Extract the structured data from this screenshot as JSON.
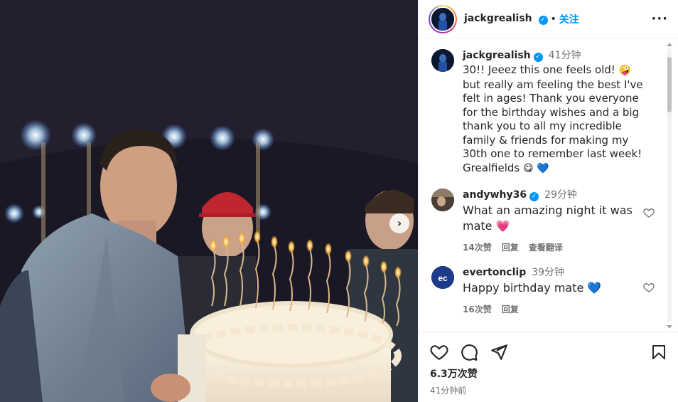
{
  "photo": {
    "next_glyph": "›",
    "icon": "chevron-right-icon"
  },
  "header": {
    "username": "jackgrealish",
    "verified_glyph": "✓",
    "separator": "•",
    "follow_label": "关注",
    "more_glyph": "···"
  },
  "caption": {
    "username": "jackgrealish",
    "time": "41分钟",
    "text_before_emoji": "30!! Jeeez this one feels old! ",
    "emoji1": "🤪",
    "text_middle": " but really am feeling the best I've felt in ages! Thank you everyone for the birthday wishes and a big thank you to all my incredible family & friends for making my 30th one to remember last week! Grealfields ",
    "emoji2": "😋",
    "emoji3": "💙"
  },
  "comments": [
    {
      "username": "andywhy36",
      "time": "29分钟",
      "text": "What an amazing night it was mate ",
      "emoji": "💗",
      "likes": "14次赞",
      "reply_label": "回复",
      "translate_label": "查看翻译"
    },
    {
      "username": "evertonclip",
      "time": "39分钟",
      "text": "Happy birthday mate ",
      "emoji": "💙",
      "likes": "16次赞",
      "reply_label": "回复",
      "avatar_text": "ec"
    }
  ],
  "footer": {
    "likes": "6.3万次赞",
    "posted": "41分钟前"
  },
  "colors": {
    "accent": "#0095f6",
    "text": "#262626",
    "muted": "#737373",
    "border": "#efefef"
  },
  "icons": [
    "heart-icon",
    "comment-icon",
    "share-icon",
    "bookmark-icon",
    "more-icon",
    "verified-icon"
  ]
}
